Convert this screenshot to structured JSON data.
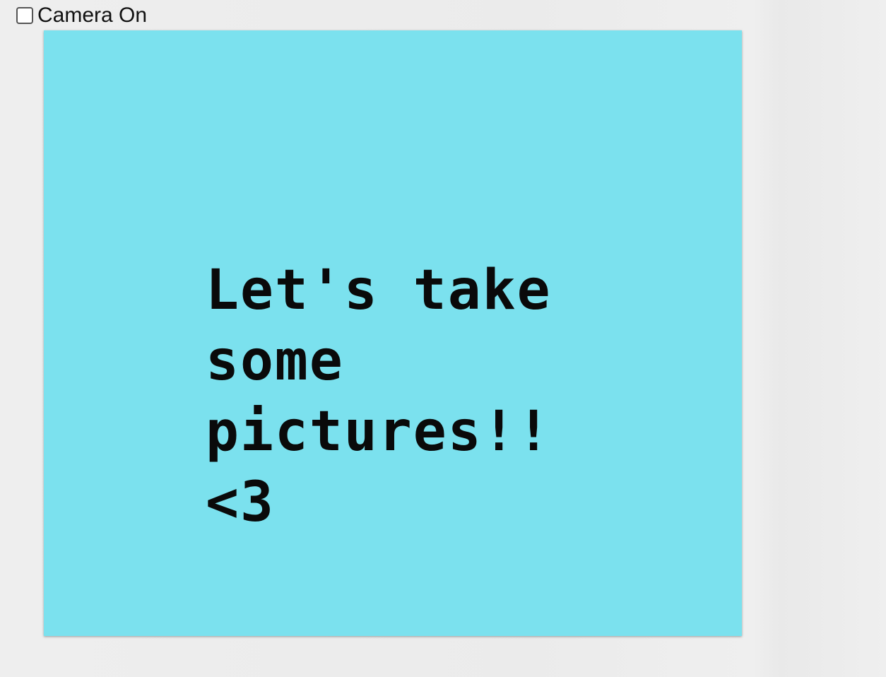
{
  "camera_toggle": {
    "label": "Camera On",
    "checked": false
  },
  "screen": {
    "background_color": "#7be1ee",
    "message": "Let's take\nsome pictures!!\n<3"
  }
}
